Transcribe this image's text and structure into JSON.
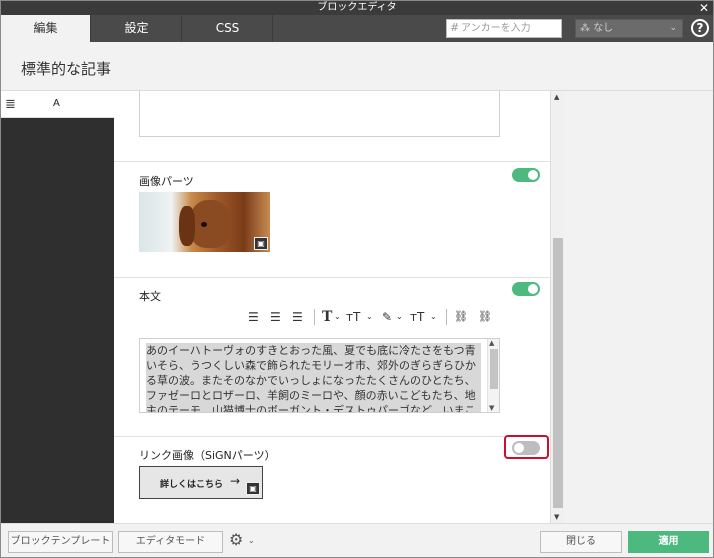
{
  "window": {
    "title": "ブロックエディタ",
    "close_glyph": "✕"
  },
  "tabs": [
    {
      "label": "編集",
      "active": true
    },
    {
      "label": "設定",
      "active": false
    },
    {
      "label": "CSS",
      "active": false
    }
  ],
  "anchor": {
    "hash": "#",
    "placeholder": "アンカーを入力"
  },
  "select": {
    "icon": "user-group-icon",
    "value": "なし",
    "chevron": "⌄"
  },
  "help": {
    "glyph": "?"
  },
  "page": {
    "title": "標準的な記事"
  },
  "leftpanel": {
    "menu_glyph": "≣",
    "label": "A"
  },
  "blocks": {
    "image": {
      "label": "画像パーツ",
      "enabled": true
    },
    "body": {
      "label": "本文",
      "enabled": true,
      "text": "あのイーハトーヴォのすきとおった風、夏でも底に冷たさをもつ青いそら、うつくしい森で飾られたモリーオ市、郊外のぎらぎらひかる草の波。またそのなかでいっしょになったたくさんのひとたち、ファゼーロとロザーロ、羊飼のミーロや、顔の赤いこどもたち、地主のテーモ、山猫博士のボーガント・デストゥパーゴなど、いまこの暗い"
    },
    "link": {
      "label": "リンク画像（SiGNパーツ）",
      "enabled": false,
      "button_text": "詳しくはこちら",
      "arrow": "→"
    }
  },
  "toolbar": {
    "text_glyph": "T",
    "size_glyph": "ᴛT",
    "chev": "⌄",
    "link_glyph": "🔗"
  },
  "footer": {
    "template_btn": "ブロックテンプレート",
    "editor_btn": "エディタモード",
    "close_btn": "閉じる",
    "apply_btn": "適用",
    "gear_glyph": "⚙",
    "gear_chev": "⌄"
  },
  "colors": {
    "accent": "#4cba7e",
    "highlight": "#c8102e",
    "tabbar": "#4a4a4a"
  }
}
